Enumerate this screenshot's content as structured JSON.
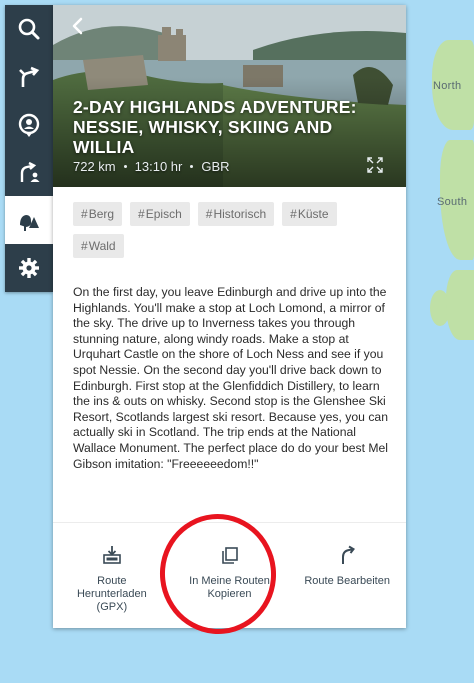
{
  "map": {
    "labels": [
      "North",
      "South"
    ]
  },
  "toolbar": {
    "items": [
      {
        "name": "search",
        "icon": "search-icon"
      },
      {
        "name": "route",
        "icon": "route-icon"
      },
      {
        "name": "places",
        "icon": "location-pin-icon"
      },
      {
        "name": "my-routes",
        "icon": "user-route-icon"
      },
      {
        "name": "explore",
        "icon": "explore-trees-icon",
        "active": true
      },
      {
        "name": "settings",
        "icon": "gear-icon"
      }
    ]
  },
  "route": {
    "title": "2-Day Highlands Adventure: Nessie, Whisky, Skiing and Willia",
    "distance": "722 km",
    "duration": "13:10 hr",
    "country": "GBR",
    "tags": [
      "Berg",
      "Episch",
      "Historisch",
      "Küste",
      "Wald"
    ],
    "description": "On the first day, you leave Edinburgh and drive up into the Highlands. You'll make a stop at Loch Lomond, a mirror of the sky. The drive up to Inverness takes you through stunning nature, along windy roads. Make a stop at Urquhart Castle on the shore of Loch Ness and see if you spot Nessie. On the second day you'll drive back down to Edinburgh. First stop at the Glenfiddich Distillery, to learn the ins & outs on whisky. Second stop is the Glenshee Ski Resort, Scotlands largest ski resort. Because yes, you can actually ski in Scotland. The trip ends at the National Wallace Monument. The perfect place do do your best Mel Gibson imitation: \"Freeeeeedom!!\""
  },
  "actions": {
    "download": "Route Herunterladen (GPX)",
    "copy": "In Meine Routen Kopieren",
    "edit": "Route Bearbeiten"
  },
  "annotation": {
    "color": "#e8141f"
  }
}
